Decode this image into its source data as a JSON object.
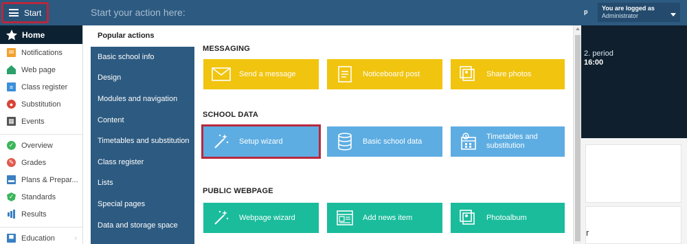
{
  "topbar": {
    "start_label": "Start",
    "search_placeholder": "Start your action here:",
    "right_p": "p",
    "logged_line1": "You are logged as",
    "logged_line2": "Administrator"
  },
  "sidebar": {
    "home_label": "Home",
    "items": [
      {
        "label": "Notifications",
        "icon": "envelope-icon"
      },
      {
        "label": "Web page",
        "icon": "house-icon"
      },
      {
        "label": "Class register",
        "icon": "register-icon"
      },
      {
        "label": "Substitution",
        "icon": "substitution-icon"
      },
      {
        "label": "Events",
        "icon": "calendar-icon"
      }
    ],
    "items2": [
      {
        "label": "Overview",
        "icon": "check-icon"
      },
      {
        "label": "Grades",
        "icon": "grades-icon"
      },
      {
        "label": "Plans & Prepar...",
        "icon": "plans-icon"
      },
      {
        "label": "Standards",
        "icon": "shield-check-icon"
      },
      {
        "label": "Results",
        "icon": "bar-chart-icon"
      }
    ],
    "items3": [
      {
        "label": "Education",
        "icon": "education-icon"
      }
    ]
  },
  "menu": {
    "categories": [
      "Popular actions",
      "Basic school info",
      "Design",
      "Modules and navigation",
      "Content",
      "Timetables and substitution",
      "Class register",
      "Lists",
      "Special pages",
      "Data and storage space"
    ],
    "sections": {
      "messaging": {
        "title": "MESSAGING",
        "tiles": [
          "Send a message",
          "Noticeboard post",
          "Share photos"
        ]
      },
      "school_data": {
        "title": "SCHOOL DATA",
        "tiles": [
          "Setup wizard",
          "Basic school data",
          "Timetables and substitution"
        ]
      },
      "public_webpage": {
        "title": "PUBLIC WEBPAGE",
        "tiles": [
          "Webpage wizard",
          "Add news item",
          "Photoalbum"
        ]
      }
    }
  },
  "background": {
    "period": "2. period",
    "time": "16:00",
    "partial_letter": "r"
  },
  "colors": {
    "nav_blue": "#2d5a80",
    "tile_yellow": "#f1c40f",
    "tile_blue": "#5dade2",
    "tile_green": "#1abc9c",
    "highlight_red": "#b8283d"
  }
}
